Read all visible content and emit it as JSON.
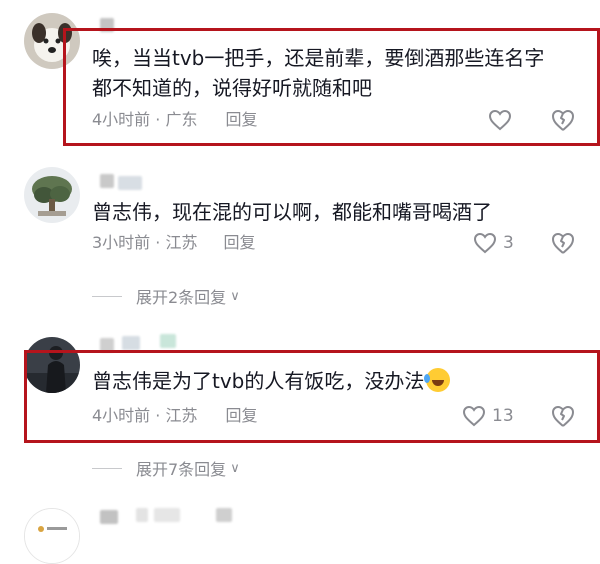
{
  "comments": [
    {
      "text": "唉，当当tvb一把手，还是前辈，要倒酒那些连名字都不知道的，说得好听就随和吧",
      "time": "4小时前",
      "location": "广东",
      "reply_label": "回复",
      "likes": ""
    },
    {
      "text": "曾志伟，现在混的可以啊，都能和嘴哥喝酒了",
      "time": "3小时前",
      "location": "江苏",
      "reply_label": "回复",
      "likes": "3",
      "expand_label": "展开2条回复"
    },
    {
      "text": "曾志伟是为了tvb的人有饭吃，没办法",
      "time": "4小时前",
      "location": "江苏",
      "reply_label": "回复",
      "likes": "13",
      "expand_label": "展开7条回复"
    }
  ],
  "colors": {
    "highlight": "#b5141c",
    "meta_text": "#8a8b91",
    "body_text": "#161823"
  },
  "icons": {
    "like": "heart-outline-icon",
    "dislike": "broken-heart-icon",
    "expand": "chevron-down-icon",
    "emoji": "rofl-emoji"
  }
}
